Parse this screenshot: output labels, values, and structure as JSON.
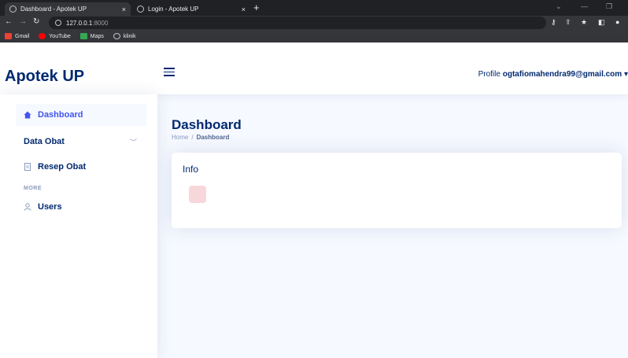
{
  "browser": {
    "tabs": [
      {
        "title": "Dashboard - Apotek UP",
        "close": "×"
      },
      {
        "title": "Login - Apotek UP",
        "close": "×"
      }
    ],
    "new_tab": "+",
    "url_host": "127.0.0.1",
    "url_port": ":8000",
    "bookmarks": [
      {
        "label": "Gmail",
        "icon": "gmail-icon",
        "color": "#ea4335"
      },
      {
        "label": "YouTube",
        "icon": "youtube-icon",
        "color": "#ff0000"
      },
      {
        "label": "Maps",
        "icon": "maps-icon",
        "color": "#34a853"
      },
      {
        "label": "klinik",
        "icon": "globe-icon",
        "color": "#bdc1c6"
      }
    ]
  },
  "header": {
    "logo": "Apotek UP",
    "profile_label": "Profile",
    "profile_email": "ogtafiomahendra99@gmail.com"
  },
  "sidebar": {
    "items": [
      {
        "label": "Dashboard",
        "icon": "house-icon",
        "active": true
      },
      {
        "label": "Data Obat",
        "icon": "",
        "chevron": "﹀"
      },
      {
        "label": "Resep Obat",
        "icon": "document-icon"
      }
    ],
    "section_heading": "MORE",
    "more_items": [
      {
        "label": "Users",
        "icon": "user-icon"
      }
    ]
  },
  "main": {
    "title": "Dashboard",
    "breadcrumb": {
      "home": "Home",
      "separator": "/",
      "current": "Dashboard"
    },
    "card": {
      "title": "Info"
    }
  },
  "colors": {
    "accent": "#4154f1",
    "heading": "#012970",
    "background": "#f6f9ff",
    "info_icon": "#f8d7da"
  }
}
